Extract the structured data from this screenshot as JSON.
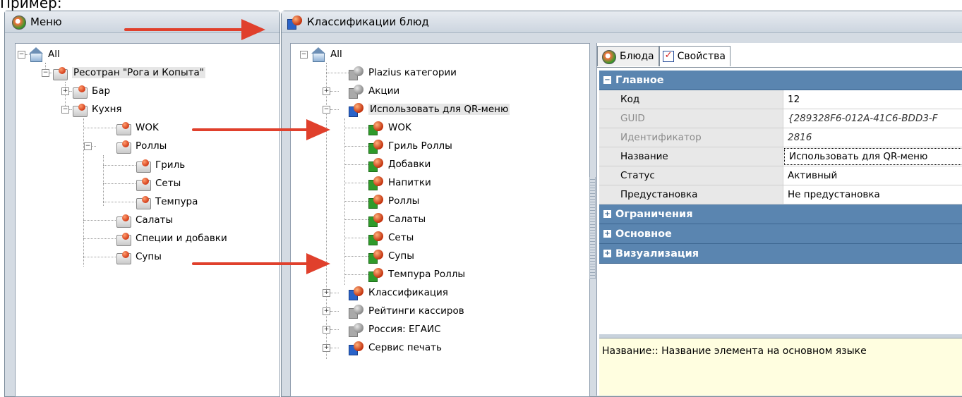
{
  "caption": "Пример:",
  "menu_panel": {
    "title": "Меню",
    "tree": [
      {
        "label": "All",
        "icon": "house-icon"
      },
      {
        "label": "Ресотран \"Рога и Копыта\"",
        "icon": "folder-icon"
      },
      {
        "label": "Бар",
        "icon": "folder-icon"
      },
      {
        "label": "Кухня",
        "icon": "folder-icon"
      },
      {
        "label": "WOK",
        "icon": "folder-icon"
      },
      {
        "label": "Роллы",
        "icon": "folder-icon"
      },
      {
        "label": "Гриль",
        "icon": "folder-icon"
      },
      {
        "label": "Сеты",
        "icon": "folder-icon"
      },
      {
        "label": "Темпура",
        "icon": "folder-icon"
      },
      {
        "label": "Салаты",
        "icon": "folder-icon"
      },
      {
        "label": "Специи и добавки",
        "icon": "folder-icon"
      },
      {
        "label": "Супы",
        "icon": "folder-icon"
      }
    ]
  },
  "class_panel": {
    "title": "Классификации блюд",
    "tree": [
      {
        "label": "All",
        "icon": "house-icon"
      },
      {
        "label": "Plazius категории",
        "icon": "gray-ball-icon"
      },
      {
        "label": "Акции",
        "icon": "gray-ball-icon"
      },
      {
        "label": "Использовать для QR-меню",
        "icon": "blue-ball-icon"
      },
      {
        "label": "WOK",
        "icon": "green-ball-icon"
      },
      {
        "label": "Гриль Роллы",
        "icon": "green-ball-icon"
      },
      {
        "label": "Добавки",
        "icon": "green-ball-icon"
      },
      {
        "label": "Напитки",
        "icon": "green-ball-icon"
      },
      {
        "label": "Роллы",
        "icon": "green-ball-icon"
      },
      {
        "label": "Салаты",
        "icon": "green-ball-icon"
      },
      {
        "label": "Сеты",
        "icon": "green-ball-icon"
      },
      {
        "label": "Супы",
        "icon": "green-ball-icon"
      },
      {
        "label": "Темпура Роллы",
        "icon": "green-ball-icon"
      },
      {
        "label": "Классификация",
        "icon": "blue-ball-icon"
      },
      {
        "label": "Рейтинги кассиров",
        "icon": "gray-ball-icon"
      },
      {
        "label": "Россия: ЕГАИС",
        "icon": "gray-ball-icon"
      },
      {
        "label": "Сервис печать",
        "icon": "blue-ball-icon"
      }
    ]
  },
  "tabs": [
    {
      "label": "Блюда",
      "icon": "dish-icon"
    },
    {
      "label": "Свойства",
      "icon": "properties-icon"
    }
  ],
  "properties": {
    "main_category": "Главное",
    "rows": [
      {
        "key": "Код",
        "value": "12"
      },
      {
        "key": "GUID",
        "value": "{289328F6-012A-41C6-BDD3-F"
      },
      {
        "key": "Идентификатор",
        "value": "2816"
      },
      {
        "key": "Название",
        "value": "Использовать для QR-меню"
      },
      {
        "key": "Статус",
        "value": "Активный"
      },
      {
        "key": "Предустановка",
        "value": "Не предустановка"
      }
    ],
    "collapsed_categories": [
      "Ограничения",
      "Основное",
      "Визуализация"
    ]
  },
  "description": "Название:: Название элемента на основном языке",
  "colors": {
    "category_header": "#5a85b0",
    "arrow": "#e0402c",
    "description_bg": "#fffee0"
  }
}
